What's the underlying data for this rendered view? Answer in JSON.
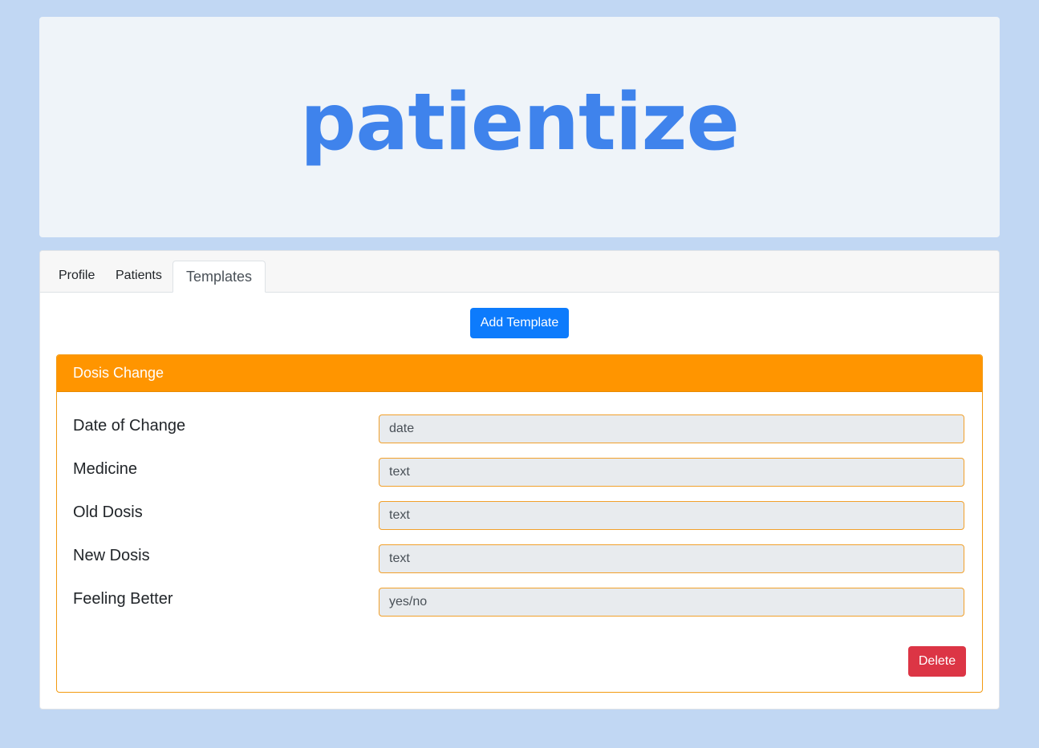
{
  "brand": {
    "logo_text": "patientize",
    "logo_color": "#3f83ec"
  },
  "tabs": [
    {
      "label": "Profile",
      "active": false
    },
    {
      "label": "Patients",
      "active": false
    },
    {
      "label": "Templates",
      "active": true
    }
  ],
  "actions": {
    "add_template_label": "Add Template",
    "add_template_color": "#0d7bfc"
  },
  "template": {
    "title": "Dosis Change",
    "header_color": "#ff9500",
    "fields": [
      {
        "label": "Date of Change",
        "placeholder": "date"
      },
      {
        "label": "Medicine",
        "placeholder": "text"
      },
      {
        "label": "Old Dosis",
        "placeholder": "text"
      },
      {
        "label": "New Dosis",
        "placeholder": "text"
      },
      {
        "label": "Feeling Better",
        "placeholder": "yes/no"
      }
    ],
    "delete_label": "Delete",
    "delete_color": "#dc3545"
  }
}
